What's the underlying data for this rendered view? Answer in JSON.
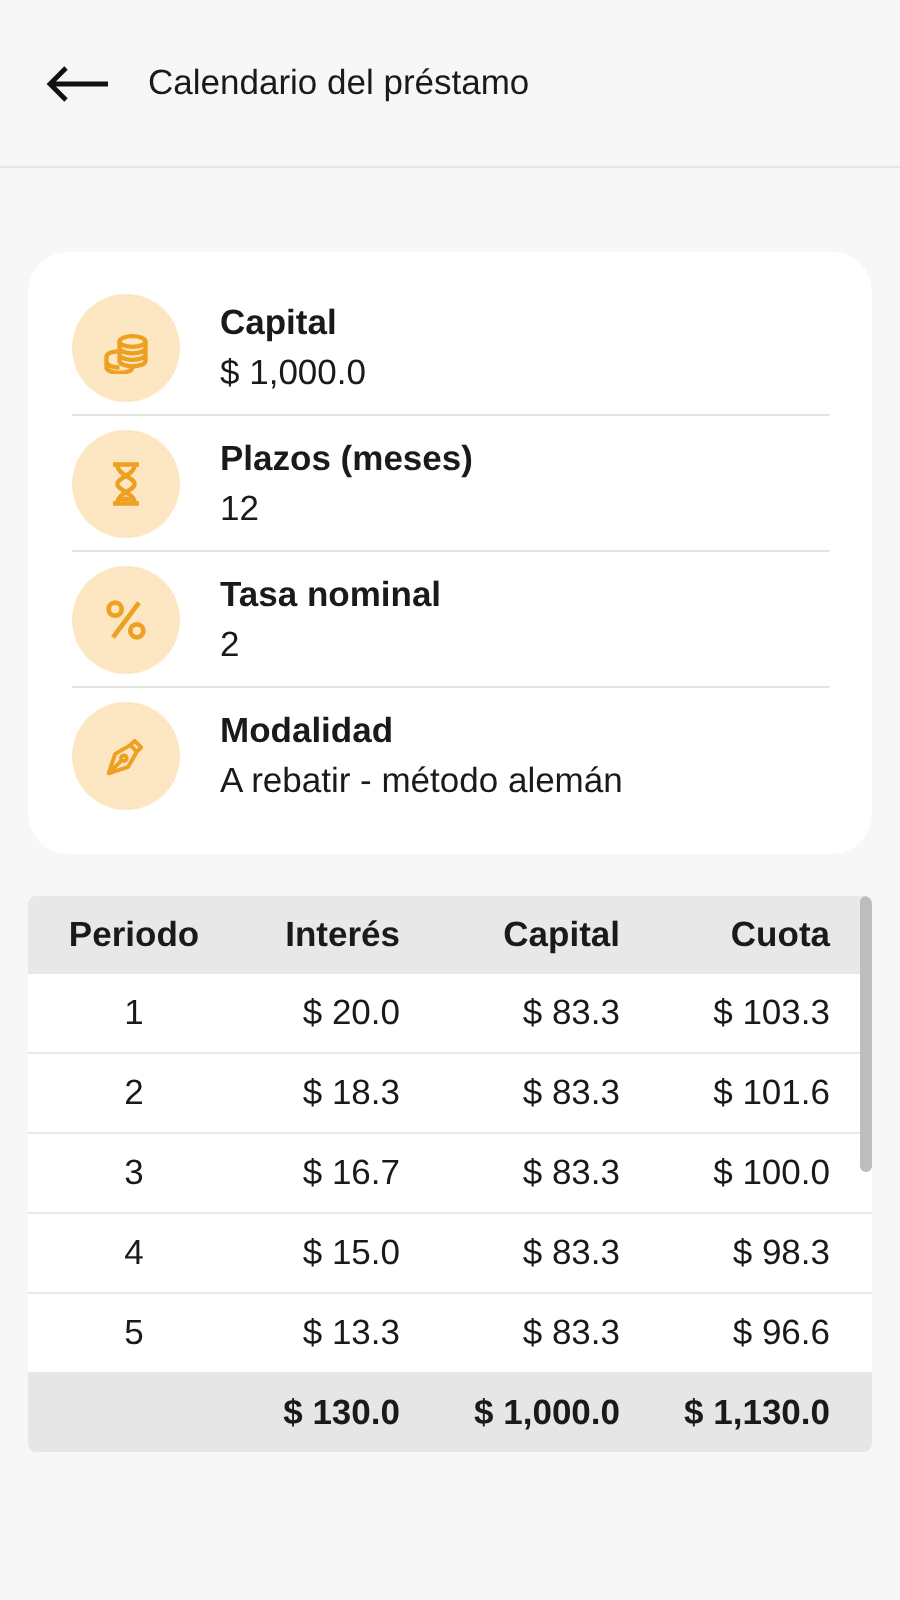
{
  "header": {
    "title": "Calendario del préstamo"
  },
  "summary": [
    {
      "label": "Capital",
      "value": "$ 1,000.0"
    },
    {
      "label": "Plazos (meses)",
      "value": "12"
    },
    {
      "label": "Tasa nominal",
      "value": "2"
    },
    {
      "label": "Modalidad",
      "value": "A rebatir - método alemán"
    }
  ],
  "table": {
    "columns": [
      "Periodo",
      "Interés",
      "Capital",
      "Cuota"
    ],
    "rows": [
      [
        "1",
        "$ 20.0",
        "$ 83.3",
        "$ 103.3"
      ],
      [
        "2",
        "$ 18.3",
        "$ 83.3",
        "$ 101.6"
      ],
      [
        "3",
        "$ 16.7",
        "$ 83.3",
        "$ 100.0"
      ],
      [
        "4",
        "$ 15.0",
        "$ 83.3",
        "$ 98.3"
      ],
      [
        "5",
        "$ 13.3",
        "$ 83.3",
        "$ 96.6"
      ]
    ],
    "totals": [
      "$ 130.0",
      "$ 1,000.0",
      "$ 1,130.0"
    ]
  }
}
